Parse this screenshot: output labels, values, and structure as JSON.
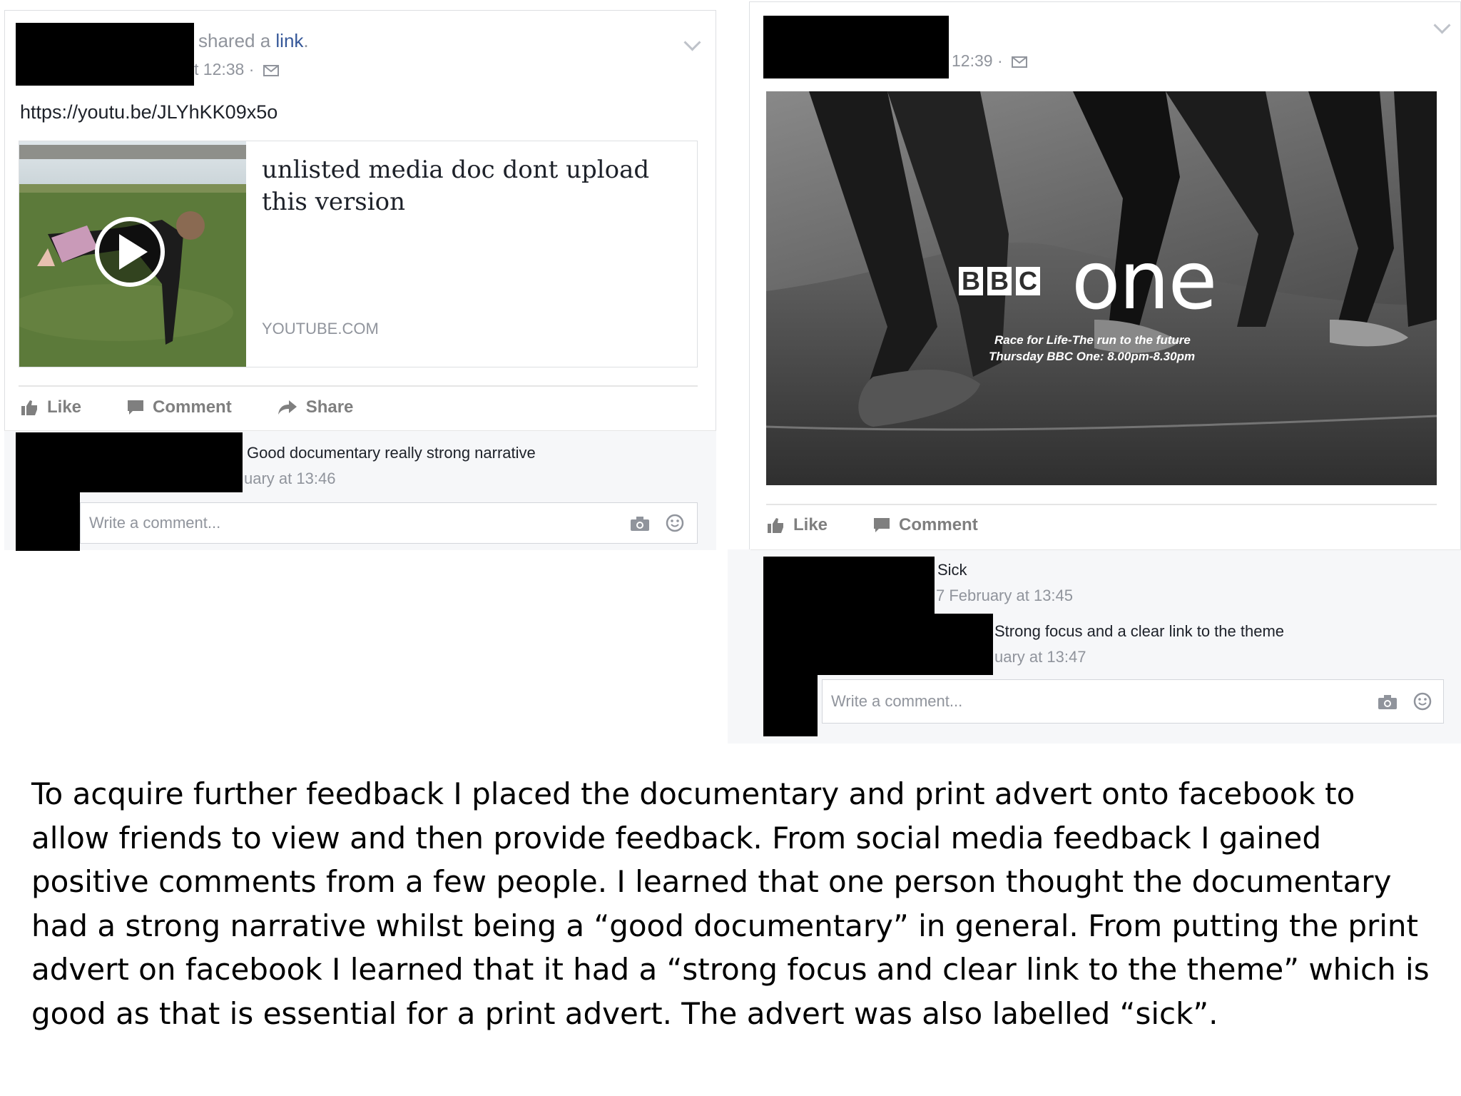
{
  "post1": {
    "shared_prefix": "shared a ",
    "shared_link": "link",
    "shared_suffix": ".",
    "time": "t 12:38 ·",
    "url": "https://youtu.be/JLYhKK09x5o",
    "preview_title": "unlisted media doc dont upload this version",
    "preview_domain": "YOUTUBE.COM",
    "actions": {
      "like": "Like",
      "comment": "Comment",
      "share": "Share"
    },
    "comment": {
      "text": "Good documentary really strong narrative",
      "time": "uary at 13:46"
    },
    "write_placeholder": "Write a comment..."
  },
  "post2": {
    "time": "12:39 ·",
    "image": {
      "logo_blocks": [
        "B",
        "B",
        "C"
      ],
      "logo_word": "one",
      "tagline_1": "Race for Life-The run to the future",
      "tagline_2": "Thursday BBC One: 8.00pm-8.30pm"
    },
    "actions": {
      "like": "Like",
      "comment": "Comment"
    },
    "comments": [
      {
        "text": "Sick",
        "time": "7 February at 13:45"
      },
      {
        "text": "Strong focus and a clear link to the theme",
        "time": "uary at 13:47"
      }
    ],
    "write_placeholder": "Write a comment..."
  },
  "caption": "To acquire further feedback I placed the documentary and print advert onto facebook to allow friends to view and then provide feedback. From social media feedback I gained positive comments from a few people. I learned that one person thought the documentary had a strong narrative whilst being a “good documentary” in general. From putting the print advert on facebook I learned that it had a “strong focus and clear link to the theme” which is good as that is essential for a print advert. The advert was also labelled “sick”.",
  "colors": {
    "link": "#365899",
    "meta": "#90949c",
    "action": "#7f7f7f",
    "comment_bg": "#f6f7f9"
  }
}
